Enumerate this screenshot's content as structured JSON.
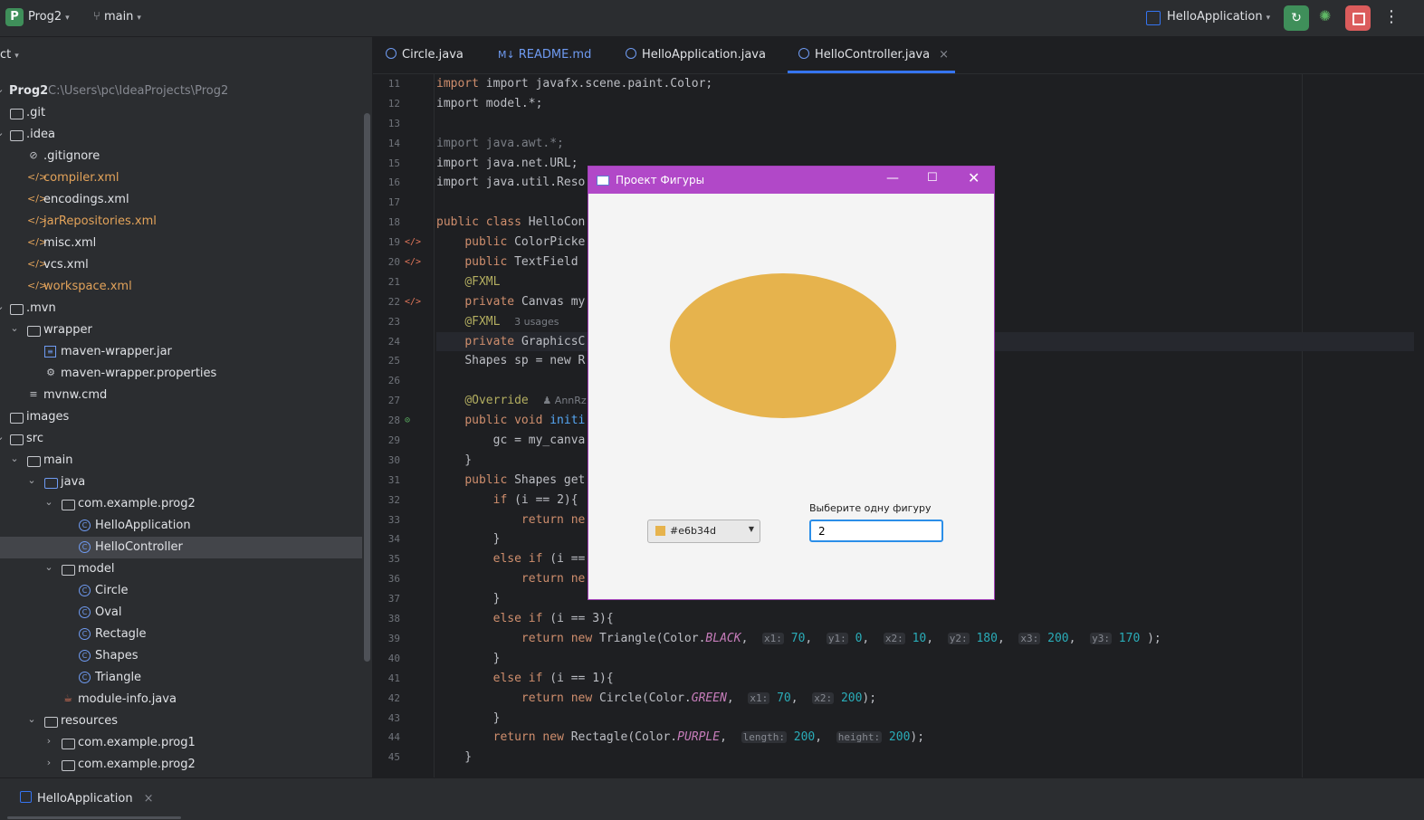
{
  "topbar": {
    "project_badge": "P",
    "project_name": "Prog2",
    "branch": "main",
    "run_config": "HelloApplication"
  },
  "sidebar": {
    "header": "ct",
    "items": [
      {
        "label": "Prog2",
        "path": "C:\\Users\\pc\\IdeaProjects\\Prog2"
      },
      {
        "label": ".git"
      },
      {
        "label": ".idea"
      },
      {
        "label": ".gitignore"
      },
      {
        "label": "compiler.xml"
      },
      {
        "label": "encodings.xml"
      },
      {
        "label": "jarRepositories.xml"
      },
      {
        "label": "misc.xml"
      },
      {
        "label": "vcs.xml"
      },
      {
        "label": "workspace.xml"
      },
      {
        "label": ".mvn"
      },
      {
        "label": "wrapper"
      },
      {
        "label": "maven-wrapper.jar"
      },
      {
        "label": "maven-wrapper.properties"
      },
      {
        "label": "mvnw.cmd"
      },
      {
        "label": "images"
      },
      {
        "label": "src"
      },
      {
        "label": "main"
      },
      {
        "label": "java"
      },
      {
        "label": "com.example.prog2"
      },
      {
        "label": "HelloApplication"
      },
      {
        "label": "HelloController"
      },
      {
        "label": "model"
      },
      {
        "label": "Circle"
      },
      {
        "label": "Oval"
      },
      {
        "label": "Rectagle"
      },
      {
        "label": "Shapes"
      },
      {
        "label": "Triangle"
      },
      {
        "label": "module-info.java"
      },
      {
        "label": "resources"
      },
      {
        "label": "com.example.prog1"
      },
      {
        "label": "com.example.prog2"
      }
    ]
  },
  "tabs": [
    {
      "label": "Circle.java"
    },
    {
      "label": "README.md",
      "prefix": "M↓"
    },
    {
      "label": "HelloApplication.java"
    },
    {
      "label": "HelloController.java",
      "close": "×"
    }
  ],
  "editor": {
    "line_numbers": [
      "11",
      "12",
      "13",
      "14",
      "15",
      "16",
      "17",
      "18",
      "19",
      "20",
      "21",
      "22",
      "23",
      "24",
      "25",
      "26",
      "27",
      "28",
      "29",
      "30",
      "31",
      "32",
      "33",
      "34",
      "35",
      "36",
      "37",
      "38",
      "39",
      "40",
      "41",
      "42",
      "43",
      "44",
      "45"
    ]
  },
  "code_text": {
    "l11": "import javafx.scene.paint.Color;",
    "l12": "import model.*;",
    "l14": "import java.awt.*;",
    "l15": "import java.net.URL;",
    "l16": "import java.util.Reso",
    "l18a": "public class",
    "l18b": " HelloCon",
    "l19": "ColorPicke",
    "l20": "TextField",
    "l21": "@FXML",
    "l22": "Canvas my",
    "l23a": "@FXML",
    "l23b": "3 usages",
    "l24": "GraphicsC",
    "l25": "Shapes sp = new R",
    "l27a": "@Override",
    "l27b": "AnnRz",
    "l28": "initi",
    "l29": "gc = my_canva",
    "l31": "Shapes get",
    "l32": "(i == 2){",
    "l35": "(i ==",
    "l38": "(i == 3){",
    "l41": "(i == 1){",
    "l39_type": "Triangle(Color.",
    "l39_const": "BLACK",
    "l42_type": "Circle(Color.",
    "l42_const": "GREEN",
    "l44_type": "Rectagle(Color.",
    "l44_const": "PURPLE",
    "hints": {
      "x1": "x1:",
      "y1": "y1:",
      "x2": "x2:",
      "y2": "y2:",
      "x3": "x3:",
      "y3": "y3:",
      "length": "length:",
      "height": "height:"
    },
    "nums": {
      "n70": "70",
      "n0": "0",
      "n10": "10",
      "n180": "180",
      "n200": "200",
      "n170": "170"
    }
  },
  "fx_window": {
    "title": "Проект Фигуры",
    "shape_color": "#e6b34d",
    "color_picker_value": "#e6b34d",
    "label": "Выберите одну фигуру",
    "input_value": "2",
    "title_bar_color": "#b148c8"
  },
  "bottom": {
    "run_tab": "HelloApplication",
    "close": "×"
  },
  "colors": {
    "accent": "#3574f0",
    "run": "#3f8f5a",
    "stop": "#db5c5c"
  }
}
